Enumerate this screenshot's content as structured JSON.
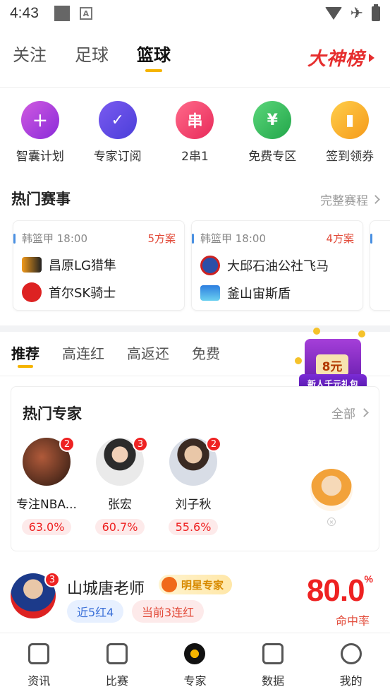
{
  "status": {
    "time": "4:43"
  },
  "top_tabs": [
    {
      "label": "关注"
    },
    {
      "label": "足球"
    },
    {
      "label": "篮球"
    }
  ],
  "promo": {
    "label": "大神榜"
  },
  "quick_entries": [
    {
      "label": "智囊计划",
      "icon": "calendar-plus-icon"
    },
    {
      "label": "专家订阅",
      "icon": "user-check-icon"
    },
    {
      "label": "2串1",
      "icon": "chuan-icon",
      "glyph": "串"
    },
    {
      "label": "免费专区",
      "icon": "money-bag-icon"
    },
    {
      "label": "签到领券",
      "icon": "coupon-icon"
    }
  ],
  "hot_matches": {
    "title": "热门赛事",
    "more": "完整赛程",
    "matches": [
      {
        "league_time": "韩篮甲 18:00",
        "count": "5方案",
        "home": "昌原LG猎隼",
        "away": "首尔SK骑士"
      },
      {
        "league_time": "韩篮甲 18:00",
        "count": "4方案",
        "home": "大邱石油公社飞马",
        "away": "釜山宙斯盾"
      }
    ]
  },
  "sub_tabs": [
    {
      "label": "推荐"
    },
    {
      "label": "高连红"
    },
    {
      "label": "高返还"
    },
    {
      "label": "免费"
    }
  ],
  "gift": {
    "amount": "8元",
    "banner": "新人千元礼包"
  },
  "hot_experts": {
    "title": "热门专家",
    "more": "全部",
    "experts": [
      {
        "name": "专注NBA...",
        "rate": "63.0%",
        "badge": "2"
      },
      {
        "name": "张宏",
        "rate": "60.7%",
        "badge": "3"
      },
      {
        "name": "刘子秋",
        "rate": "55.6%",
        "badge": "2"
      }
    ]
  },
  "star_expert": {
    "name": "山城唐老师",
    "tag": "明星专家",
    "badge": "3",
    "chip_recent": "近5红4",
    "chip_streak": "当前3连红",
    "rate": "80.0",
    "rate_unit": "%",
    "rate_label": "命中率"
  },
  "bottom_nav": [
    {
      "label": "资讯",
      "icon": "news-icon"
    },
    {
      "label": "比赛",
      "icon": "match-icon"
    },
    {
      "label": "专家",
      "icon": "expert-icon"
    },
    {
      "label": "数据",
      "icon": "data-icon"
    },
    {
      "label": "我的",
      "icon": "me-icon"
    }
  ],
  "colors": {
    "accent": "#f5b400",
    "red": "#e62e2e"
  }
}
